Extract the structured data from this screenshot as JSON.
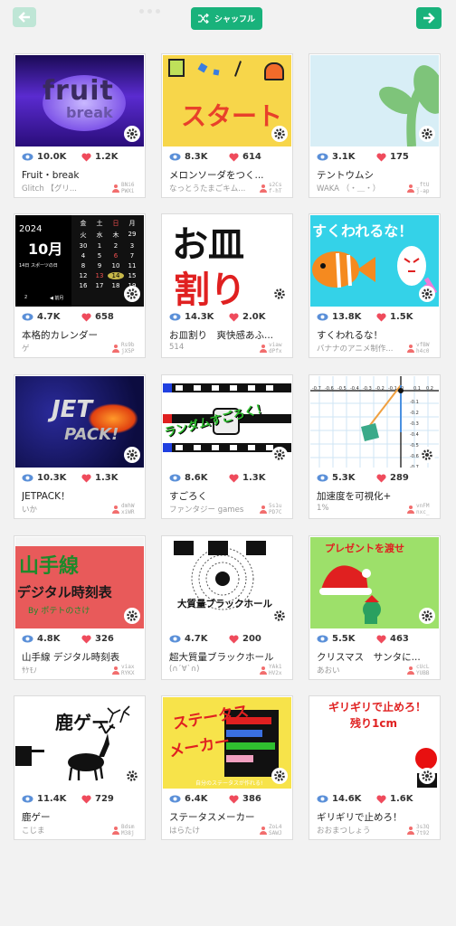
{
  "toolbar": {
    "shuffle_label": "シャッフル",
    "accent_color": "#19b27b"
  },
  "cards": [
    {
      "views": "10.0K",
      "likes": "1.2K",
      "title": "Fruit・break",
      "author": "Glitch 【グリ...",
      "uid": "BNi6\nPWXi",
      "thumb_text": [
        "fruit",
        "break"
      ]
    },
    {
      "views": "8.3K",
      "likes": "614",
      "title": "メロンソーダをつく...",
      "author": "なっとうたまごキム...",
      "uid": "s2Cs\nf-hT",
      "thumb_text": [
        "スタート"
      ]
    },
    {
      "views": "3.1K",
      "likes": "175",
      "title": "テントウムシ",
      "author": "WAKA （・＿・）",
      "uid": "_ftU\nj-ap",
      "thumb_text": []
    },
    {
      "views": "4.7K",
      "likes": "658",
      "title": "本格的カレンダー",
      "author": "ゲ",
      "uid": "Rs9b\njX5P",
      "thumb_text": [
        "2024",
        "10月",
        "14日 スポーツの日",
        "金",
        "土",
        "日",
        "月",
        "火",
        "水",
        "木",
        "29",
        "30",
        "1",
        "2",
        "3",
        "4",
        "5",
        "6",
        "7",
        "8",
        "9",
        "10",
        "11",
        "12",
        "13",
        "14",
        "15",
        "16",
        "17",
        "18",
        "19",
        "20",
        "21",
        "22",
        "23",
        "24",
        "25",
        "26",
        "27",
        "28",
        "29",
        "30",
        "31",
        "1",
        "2",
        "◀ 前月",
        "つぎ ▶"
      ]
    },
    {
      "views": "14.3K",
      "likes": "2.0K",
      "title": "お皿割り　爽快感あふ...",
      "author": "514",
      "uid": "viaw\ndPfx",
      "thumb_text": [
        "お皿",
        "割り"
      ]
    },
    {
      "views": "13.8K",
      "likes": "1.5K",
      "title": "すくわれるな！",
      "author": "バナナのアニメ制作...",
      "uid": "vfBW\nh4c0",
      "thumb_text": [
        "すくわれるな！"
      ]
    },
    {
      "views": "10.3K",
      "likes": "1.3K",
      "title": "JETPACK！",
      "author": "いか",
      "uid": "dmhW\nxiWR",
      "thumb_text": [
        "JET",
        "PACK!"
      ]
    },
    {
      "views": "8.6K",
      "likes": "1.3K",
      "title": "すごろく",
      "author": "ファンタジー games",
      "uid": "5s1u\nPD7C",
      "thumb_text": [
        "ランダムすごろく！"
      ]
    },
    {
      "views": "5.3K",
      "likes": "289",
      "title": "加速度を可視化+",
      "author": "1%",
      "uid": "vnFM\nnxc_",
      "thumb_text": [
        "-0.7",
        "-0.6",
        "-0.5",
        "-0.4",
        "-0.3",
        "-0.2",
        "-0.1",
        "0",
        "0.1",
        "0.2",
        "-0.1",
        "-0.2",
        "-0.3",
        "-0.4",
        "-0.5",
        "-0.6",
        "-0.7"
      ]
    },
    {
      "views": "4.8K",
      "likes": "326",
      "title": "山手線 デジタル時刻表",
      "author": "ｻｹﾓﾉ",
      "uid": "viax\nRYKX",
      "thumb_text": [
        "山手線",
        "デジタル時刻表",
        "By ポテトのさけ"
      ]
    },
    {
      "views": "4.7K",
      "likes": "200",
      "title": "超大質量ブラックホール",
      "author": "(∩´∀`∩)",
      "uid": "YAk1\nHV2x",
      "thumb_text": [
        "大質量ブラックホール"
      ]
    },
    {
      "views": "5.5K",
      "likes": "463",
      "title": "クリスマス　サンタに...",
      "author": "あおい",
      "uid": "cUcL\nYUBB",
      "thumb_text": [
        "プレゼントを渡せ"
      ]
    },
    {
      "views": "11.4K",
      "likes": "729",
      "title": "鹿ゲー",
      "author": "こじま",
      "uid": "Bdsm\nM38j",
      "thumb_text": [
        "鹿ゲー"
      ]
    },
    {
      "views": "6.4K",
      "likes": "386",
      "title": "ステータスメーカー",
      "author": "はらたけ",
      "uid": "ZoL4\nSAWJ",
      "thumb_text": [
        "ステータス",
        "メーカー",
        "自分のステータスが作れる!",
        "攻撃力",
        "防御力",
        "素早さ",
        "賢さ"
      ]
    },
    {
      "views": "14.6K",
      "likes": "1.6K",
      "title": "ギリギリで止めろ！",
      "author": "おおまつしょう",
      "uid": "3s3Q\n7t92",
      "thumb_text": [
        "ギリギリで止めろ！",
        "残り1cm"
      ]
    }
  ]
}
